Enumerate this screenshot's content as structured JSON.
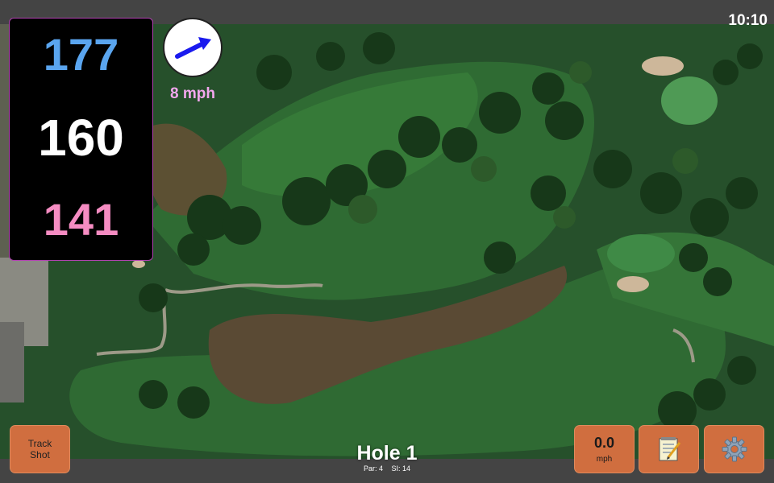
{
  "status_bar": {
    "clock": "10:10"
  },
  "yardages": {
    "back": "177",
    "center": "160",
    "front": "141"
  },
  "wind": {
    "speed": "8 mph",
    "direction_icon": "wind-arrow-icon"
  },
  "hole": {
    "title": "Hole 1",
    "par_label": "Par: 4",
    "si_label": "SI: 14"
  },
  "buttons": {
    "track_shot_line1": "Track",
    "track_shot_line2": "Shot",
    "speed_value": "0.0",
    "speed_unit": "mph",
    "notes_icon": "notepad-icon",
    "settings_icon": "gear-icon"
  },
  "colors": {
    "back_yardage": "#5aa5ef",
    "center_yardage": "#ffffff",
    "front_yardage": "#f58cc2",
    "wind_text": "#f3a7ee",
    "button_orange": "#d06e3f"
  }
}
